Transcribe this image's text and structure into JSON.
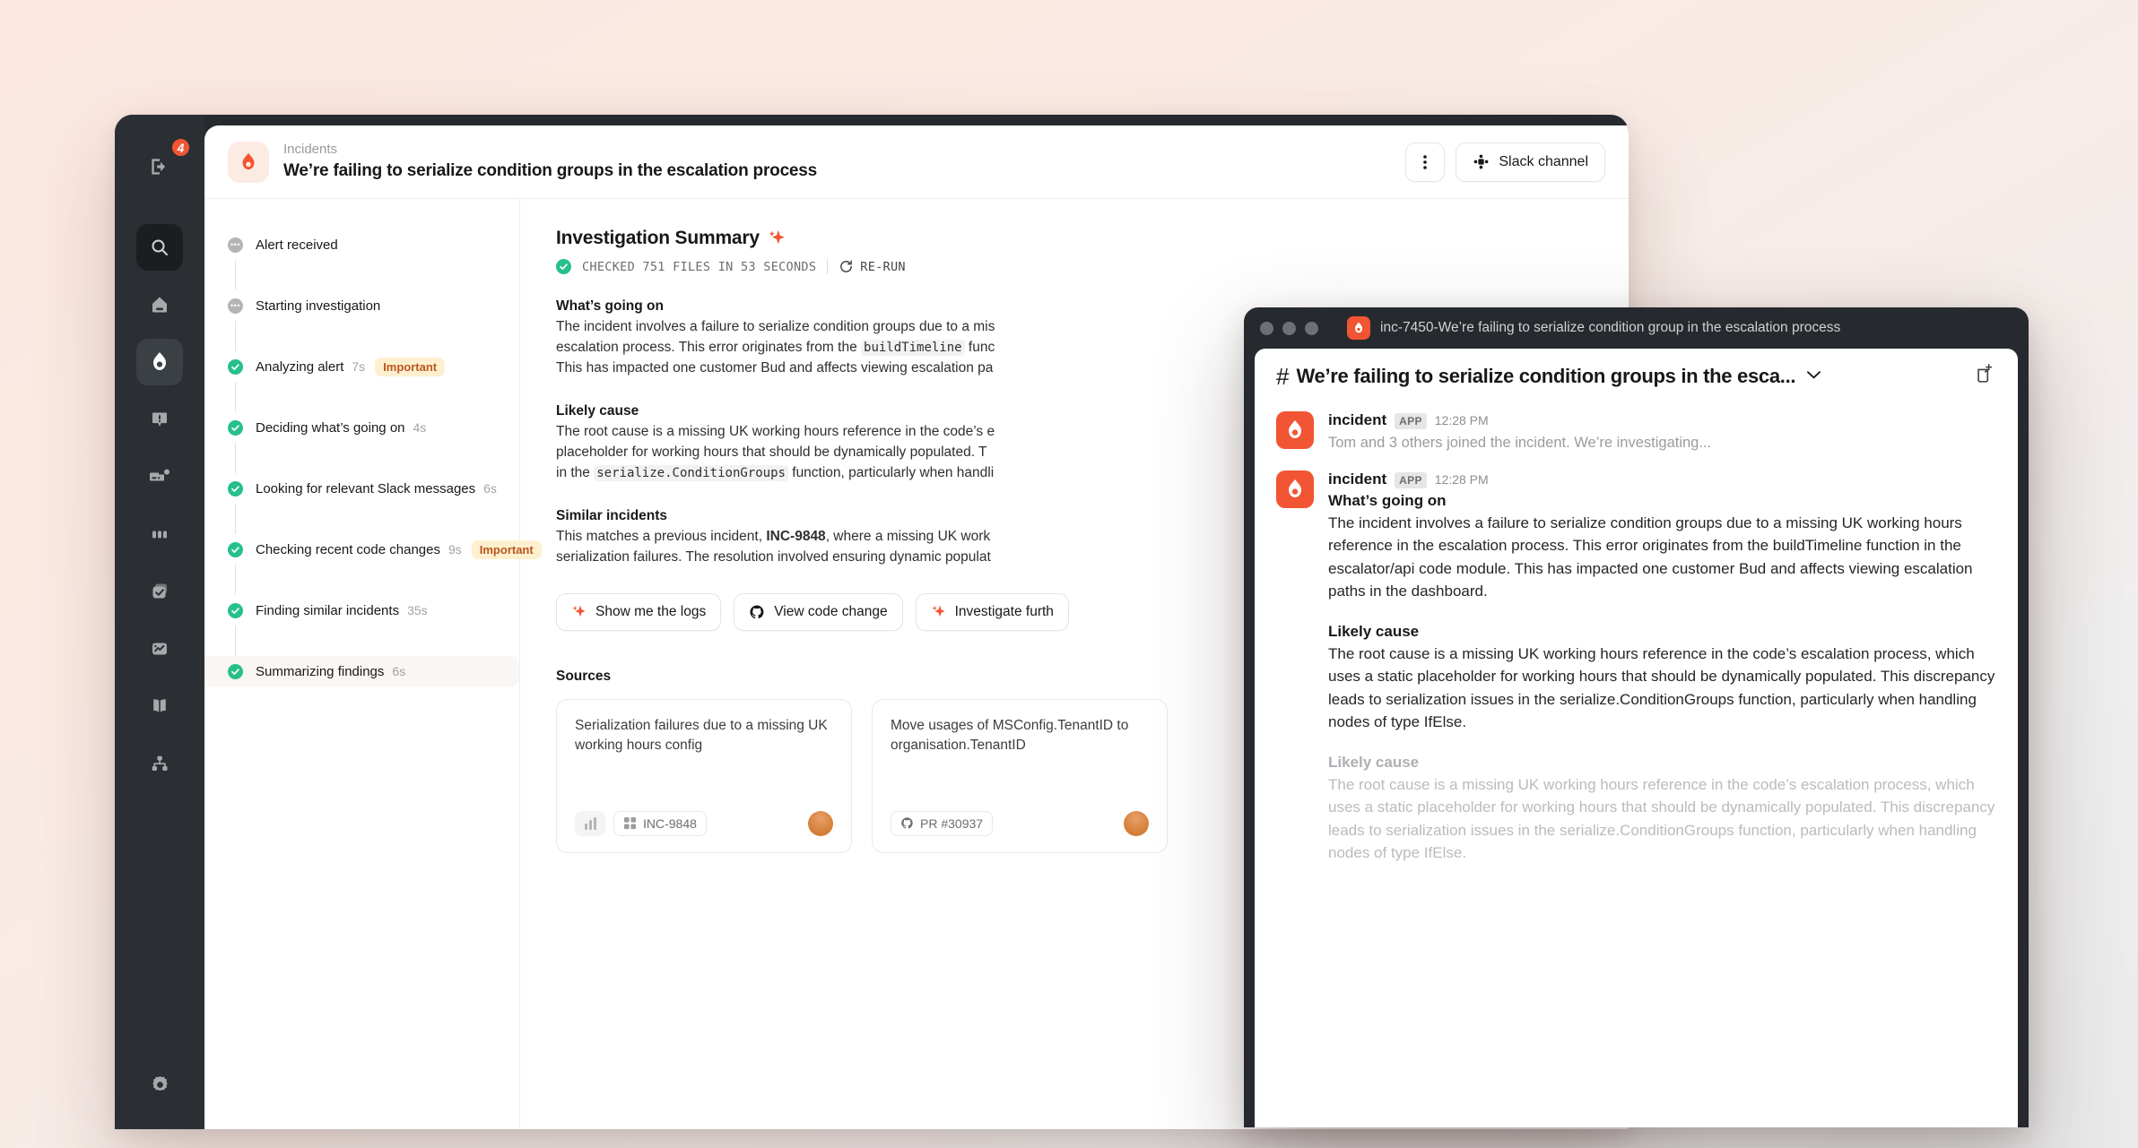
{
  "rail": {
    "notifications_badge": "4",
    "items": [
      {
        "name": "inbox-icon",
        "label": "Inbox"
      },
      {
        "name": "search-icon",
        "label": "Search"
      },
      {
        "name": "home-icon",
        "label": "Home"
      },
      {
        "name": "incidents-flame-icon",
        "label": "Incidents"
      },
      {
        "name": "alerts-icon",
        "label": "Alerts"
      },
      {
        "name": "on-call-icon",
        "label": "On-call"
      },
      {
        "name": "status-pages-icon",
        "label": "Status pages"
      },
      {
        "name": "follow-ups-icon",
        "label": "Follow-ups"
      },
      {
        "name": "insights-icon",
        "label": "Insights"
      },
      {
        "name": "catalog-icon",
        "label": "Catalog"
      },
      {
        "name": "workflows-icon",
        "label": "Workflows"
      },
      {
        "name": "settings-icon",
        "label": "Settings"
      }
    ]
  },
  "header": {
    "breadcrumb": "Incidents",
    "title": "We’re failing to serialize condition groups in the escalation process",
    "more_button_label": "⋮",
    "slack_button_label": "Slack channel"
  },
  "timeline": {
    "items": [
      {
        "status": "pending",
        "label": "Alert received",
        "duration": "",
        "badge": ""
      },
      {
        "status": "pending",
        "label": "Starting investigation",
        "duration": "",
        "badge": ""
      },
      {
        "status": "done",
        "label": "Analyzing alert",
        "duration": "7s",
        "badge": "Important"
      },
      {
        "status": "done",
        "label": "Deciding what’s going on",
        "duration": "4s",
        "badge": ""
      },
      {
        "status": "done",
        "label": "Looking for relevant Slack messages",
        "duration": "6s",
        "badge": ""
      },
      {
        "status": "done",
        "label": "Checking recent code changes",
        "duration": "9s",
        "badge": "Important"
      },
      {
        "status": "done",
        "label": "Finding similar incidents",
        "duration": "35s",
        "badge": ""
      },
      {
        "status": "done",
        "label": "Summarizing findings",
        "duration": "6s",
        "badge": "",
        "highlight": true
      }
    ]
  },
  "summary": {
    "title": "Investigation Summary",
    "meta": "CHECKED 751 FILES IN 53 SECONDS",
    "rerun_label": "RE-RUN",
    "whats_going_on_heading": "What’s going on",
    "whats_going_on_p1": "The incident involves a failure to serialize condition groups due to a mis",
    "whats_going_on_code": "buildTimeline",
    "whats_going_on_p2": "escalation process. This error originates from the ",
    "whats_going_on_p3": " func",
    "whats_going_on_p4": "This has impacted one customer Bud and affects viewing escalation pa",
    "likely_cause_heading": "Likely cause",
    "likely_cause_p1": "The root cause is a missing UK working hours reference in the code’s e",
    "likely_cause_p2": "placeholder for working hours that should be dynamically populated. T",
    "likely_cause_p3_pre": "in the ",
    "likely_cause_code": "serialize.ConditionGroups",
    "likely_cause_p3_post": " function, particularly when handli",
    "similar_heading": "Similar incidents",
    "similar_p1_pre": "This matches a previous incident, ",
    "similar_p1_bold": "INC-9848",
    "similar_p1_post": ", where a missing UK work",
    "similar_p2": "serialization failures. The resolution involved ensuring dynamic populat",
    "chips": [
      {
        "icon": "sparkle-icon",
        "label": "Show me the logs"
      },
      {
        "icon": "github-icon",
        "label": "View code change"
      },
      {
        "icon": "sparkle-icon",
        "label": "Investigate furth"
      }
    ],
    "sources_heading": "Sources",
    "sources": [
      {
        "title": "Serialization failures due to a missing UK working hours config",
        "chart_icon": "bar-chart-icon",
        "pill_icon": "incident-grid-icon",
        "pill_label": "INC-9848",
        "avatar": "user-avatar"
      },
      {
        "title": "Move usages of MSConfig.TenantID to organisation.TenantID",
        "pill_icon": "github-icon",
        "pill_label": "PR #30937",
        "avatar": "user-avatar"
      }
    ]
  },
  "slack": {
    "window_title": "inc-7450-We’re failing to serialize condition group in the escalation process",
    "channel_name": "We’re failing to serialize condition groups in the esca...",
    "hash": "#",
    "messages": [
      {
        "author": "incident",
        "app_tag": "APP",
        "time": "12:28 PM",
        "muted_text": "Tom and 3 others joined the incident. We’re investigating..."
      },
      {
        "author": "incident",
        "app_tag": "APP",
        "time": "12:28 PM",
        "heading": "What’s going on",
        "body": "The incident involves a failure to serialize condition groups due to a missing UK working hours reference in the escalation process. This error originates from the buildTimeline function in the escalator/api code module. This has impacted one customer Bud and affects viewing escalation paths in the dashboard.",
        "heading2": "Likely cause",
        "body2": "The root cause is a missing UK working hours reference in the code’s escalation process, which uses a static placeholder for working hours that should be dynamically populated. This discrepancy leads to serialization issues in the serialize.ConditionGroups function, particularly when handling nodes of type IfElse.",
        "heading3": "Likely cause",
        "body3": "The root cause is a missing UK working hours reference in the code’s escalation process, which uses a static placeholder for working hours that should be dynamically populated. This discrepancy leads to serialization issues in the serialize.ConditionGroups function, particularly when handling nodes of type IfElse."
      }
    ]
  },
  "colors": {
    "accent": "#f25533",
    "success": "#27c08a",
    "badge_bg": "#fdf0cf",
    "badge_fg": "#b9561f",
    "dark": "#2b2f33"
  }
}
